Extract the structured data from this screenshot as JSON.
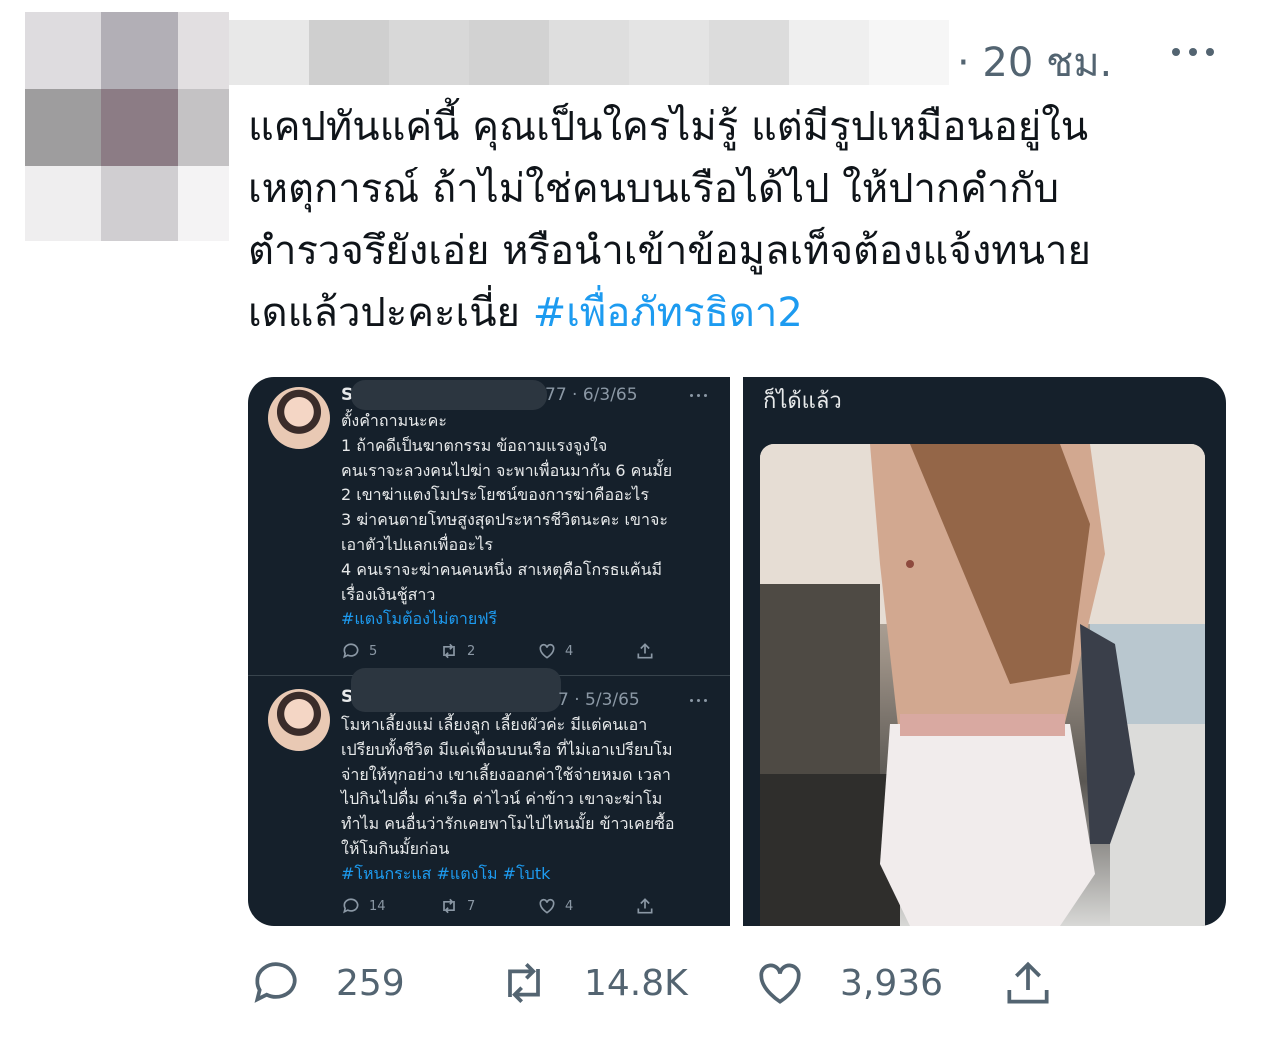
{
  "author": {
    "avatar": "blurred-avatar",
    "name": "blurred-name"
  },
  "tweet": {
    "timestamp": "· 20 ชม.",
    "lines": [
      "แคปทันแค่นี้ คุณเป็นใครไม่รู้ แต่มีรูปเหมือนอยู่ใน",
      "เหตุการณ์ ถ้าไม่ใช่คนบนเรือได้ไป ให้ปากคำกับ",
      "ตำรวจรึยังเอ่ย หรือนำเข้าข้อมูลเท็จต้องแจ้งทนาย",
      "เดแล้วปะคะเนี่ย"
    ],
    "hashtag": "#เพื่อภัทรธิดา2"
  },
  "embedded_left": {
    "tweets": [
      {
        "name": "S",
        "date": "77 · 6/3/65",
        "lines": [
          "ตั้งคำถามนะคะ",
          "1 ถ้าคดีเป็นฆาตกรรม ข้อถามแรงจูงใจ",
          "คนเราจะลวงคนไปฆ่า จะพาเพื่อนมากัน 6 คนมั้ย",
          "2 เขาฆ่าแตงโมประโยชน์ของการฆ่าคืออะไร",
          "3  ฆ่าคนตายโทษสูงสุดประหารชีวิตนะคะ เขาจะ",
          "เอาตัวไปแลกเพื่ออะไร",
          "4 คนเราจะฆ่าคนคนหนึ่ง สาเหตุคือโกรธแค้นมี",
          "เรื่องเงินชู้สาว"
        ],
        "tags": "#แตงโมต้องไม่ตายฟรี",
        "replies": "5",
        "retweets": "2",
        "likes": "4"
      },
      {
        "name": "S",
        "date": "7 · 5/3/65",
        "lines": [
          "โมหาเลี้ยงแม่ เลี้ยงลูก เลี้ยงผัวค่ะ มีแต่คนเอา",
          "เปรียบทั้งชีวิต มีแค่เพื่อนบนเรือ ที่ไม่เอาเปรียบโม",
          "จ่ายให้ทุกอย่าง เขาเลี้ยงออกค่าใช้จ่ายหมด เวลา",
          "ไปกินไปดื่ม ค่าเรือ ค่าไวน์ ค่าข้าว เขาจะฆ่าโม",
          "ทำไม  คนอื่นว่ารักเคยพาโมไปไหนมั้ย ข้าวเคยซื้อ",
          "ให้โมกินมั้ยก่อน"
        ],
        "tags": "#โหนกระแส #แตงโม #โบtk",
        "replies": "14",
        "retweets": "7",
        "likes": "4"
      }
    ]
  },
  "embedded_right": {
    "caption": "ก็ได้แล้ว",
    "photo": "photo-person-on-boat"
  },
  "actions": {
    "replies": "259",
    "retweets": "14.8K",
    "likes": "3,936"
  },
  "colors": {
    "link": "#1d9bf0",
    "muted": "#536471",
    "dark_bg": "#15202b"
  }
}
